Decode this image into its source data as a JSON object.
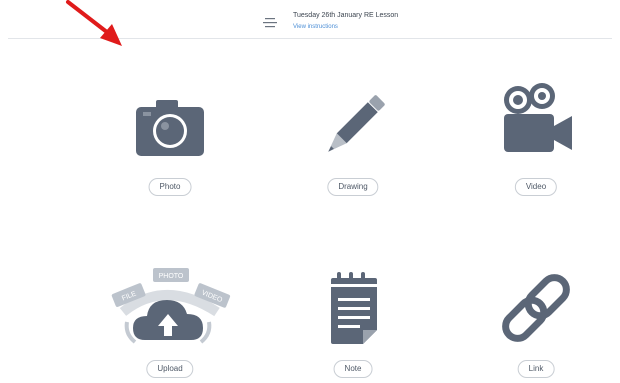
{
  "header": {
    "lesson_title": "Tuesday 26th January RE Lesson",
    "instructions_link": "View instructions"
  },
  "colors": {
    "icon": "#5b6677",
    "pill_border": "#c9ced4",
    "arrow": "#e01b1b",
    "link": "#4d8fd6"
  },
  "options": [
    {
      "label": "Photo",
      "icon": "camera-icon"
    },
    {
      "label": "Drawing",
      "icon": "pencil-icon"
    },
    {
      "label": "Video",
      "icon": "video-camera-icon"
    },
    {
      "label": "Upload",
      "icon": "cloud-upload-icon"
    },
    {
      "label": "Note",
      "icon": "notepad-icon"
    },
    {
      "label": "Link",
      "icon": "chain-link-icon"
    }
  ],
  "upload_badges": [
    "FILE",
    "PHOTO",
    "VIDEO"
  ]
}
